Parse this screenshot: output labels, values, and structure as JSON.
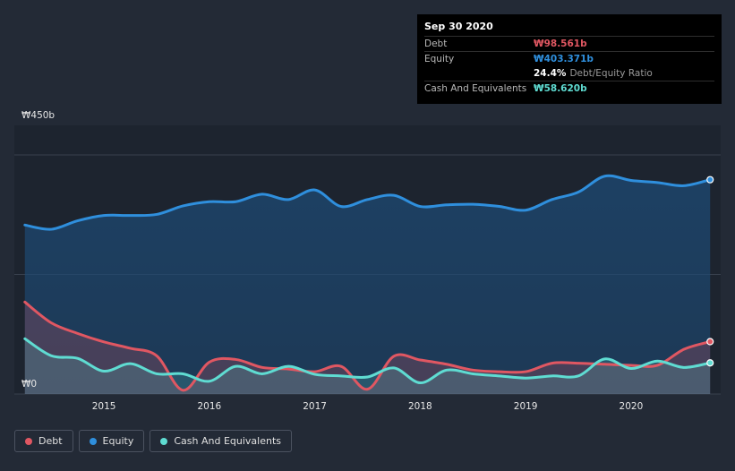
{
  "chart_data": {
    "type": "area",
    "ylim": [
      0,
      450
    ],
    "y_ticks": [
      {
        "value": 450,
        "label": "₩450b"
      },
      {
        "value": 0,
        "label": "₩0"
      }
    ],
    "x_ticks": [
      {
        "x": 2015.0,
        "label": "2015"
      },
      {
        "x": 2016.0,
        "label": "2016"
      },
      {
        "x": 2017.0,
        "label": "2017"
      },
      {
        "x": 2018.0,
        "label": "2018"
      },
      {
        "x": 2019.0,
        "label": "2019"
      },
      {
        "x": 2020.0,
        "label": "2020"
      }
    ],
    "xlim": [
      2014.15,
      2020.85
    ],
    "grid": true,
    "series": [
      {
        "name": "Equity",
        "color": "#2f8fdd",
        "points": [
          [
            2014.25,
            318
          ],
          [
            2014.5,
            310
          ],
          [
            2014.75,
            326
          ],
          [
            2015.0,
            336
          ],
          [
            2015.25,
            336
          ],
          [
            2015.5,
            338
          ],
          [
            2015.75,
            354
          ],
          [
            2016.0,
            362
          ],
          [
            2016.25,
            362
          ],
          [
            2016.5,
            376
          ],
          [
            2016.75,
            366
          ],
          [
            2017.0,
            384
          ],
          [
            2017.25,
            353
          ],
          [
            2017.5,
            366
          ],
          [
            2017.75,
            374
          ],
          [
            2018.0,
            353
          ],
          [
            2018.25,
            356
          ],
          [
            2018.5,
            357
          ],
          [
            2018.75,
            353
          ],
          [
            2019.0,
            346
          ],
          [
            2019.25,
            366
          ],
          [
            2019.5,
            380
          ],
          [
            2019.75,
            410
          ],
          [
            2020.0,
            402
          ],
          [
            2020.25,
            398
          ],
          [
            2020.5,
            392
          ],
          [
            2020.75,
            403.371
          ]
        ]
      },
      {
        "name": "Debt",
        "color": "#e05762",
        "points": [
          [
            2014.25,
            173
          ],
          [
            2014.5,
            134
          ],
          [
            2014.75,
            114
          ],
          [
            2015.0,
            98
          ],
          [
            2015.25,
            86
          ],
          [
            2015.5,
            72
          ],
          [
            2015.75,
            7
          ],
          [
            2016.0,
            60
          ],
          [
            2016.25,
            65
          ],
          [
            2016.5,
            50
          ],
          [
            2016.75,
            47
          ],
          [
            2017.0,
            42
          ],
          [
            2017.25,
            52
          ],
          [
            2017.5,
            9
          ],
          [
            2017.75,
            71
          ],
          [
            2018.0,
            64
          ],
          [
            2018.25,
            56
          ],
          [
            2018.5,
            45
          ],
          [
            2018.75,
            42
          ],
          [
            2019.0,
            42
          ],
          [
            2019.25,
            58
          ],
          [
            2019.5,
            58
          ],
          [
            2019.75,
            56
          ],
          [
            2020.0,
            54
          ],
          [
            2020.25,
            54
          ],
          [
            2020.5,
            84
          ],
          [
            2020.75,
            98.561
          ]
        ]
      },
      {
        "name": "Cash And Equivalents",
        "color": "#5fdcd2",
        "points": [
          [
            2014.25,
            104
          ],
          [
            2014.5,
            72
          ],
          [
            2014.75,
            67
          ],
          [
            2015.0,
            43
          ],
          [
            2015.25,
            57
          ],
          [
            2015.5,
            38
          ],
          [
            2015.75,
            38
          ],
          [
            2016.0,
            24
          ],
          [
            2016.25,
            52
          ],
          [
            2016.5,
            38
          ],
          [
            2016.75,
            52
          ],
          [
            2017.0,
            37
          ],
          [
            2017.25,
            34
          ],
          [
            2017.5,
            32
          ],
          [
            2017.75,
            49
          ],
          [
            2018.0,
            21
          ],
          [
            2018.25,
            45
          ],
          [
            2018.5,
            38
          ],
          [
            2018.75,
            34
          ],
          [
            2019.0,
            30
          ],
          [
            2019.25,
            34
          ],
          [
            2019.5,
            34
          ],
          [
            2019.75,
            66
          ],
          [
            2020.0,
            48
          ],
          [
            2020.25,
            62
          ],
          [
            2020.5,
            50
          ],
          [
            2020.75,
            58.62
          ]
        ]
      }
    ]
  },
  "tooltip": {
    "date": "Sep 30 2020",
    "debt_label": "Debt",
    "debt_value": "₩98.561b",
    "equity_label": "Equity",
    "equity_value": "₩403.371b",
    "ratio_value": "24.4%",
    "ratio_label": "Debt/Equity Ratio",
    "cash_label": "Cash And Equivalents",
    "cash_value": "₩58.620b",
    "colors": {
      "debt": "#e05762",
      "equity": "#2f8fdd",
      "cash": "#5fdcd2"
    }
  },
  "legend": [
    {
      "label": "Debt",
      "color": "#e05762"
    },
    {
      "label": "Equity",
      "color": "#2f8fdd"
    },
    {
      "label": "Cash And Equivalents",
      "color": "#5fdcd2"
    }
  ]
}
